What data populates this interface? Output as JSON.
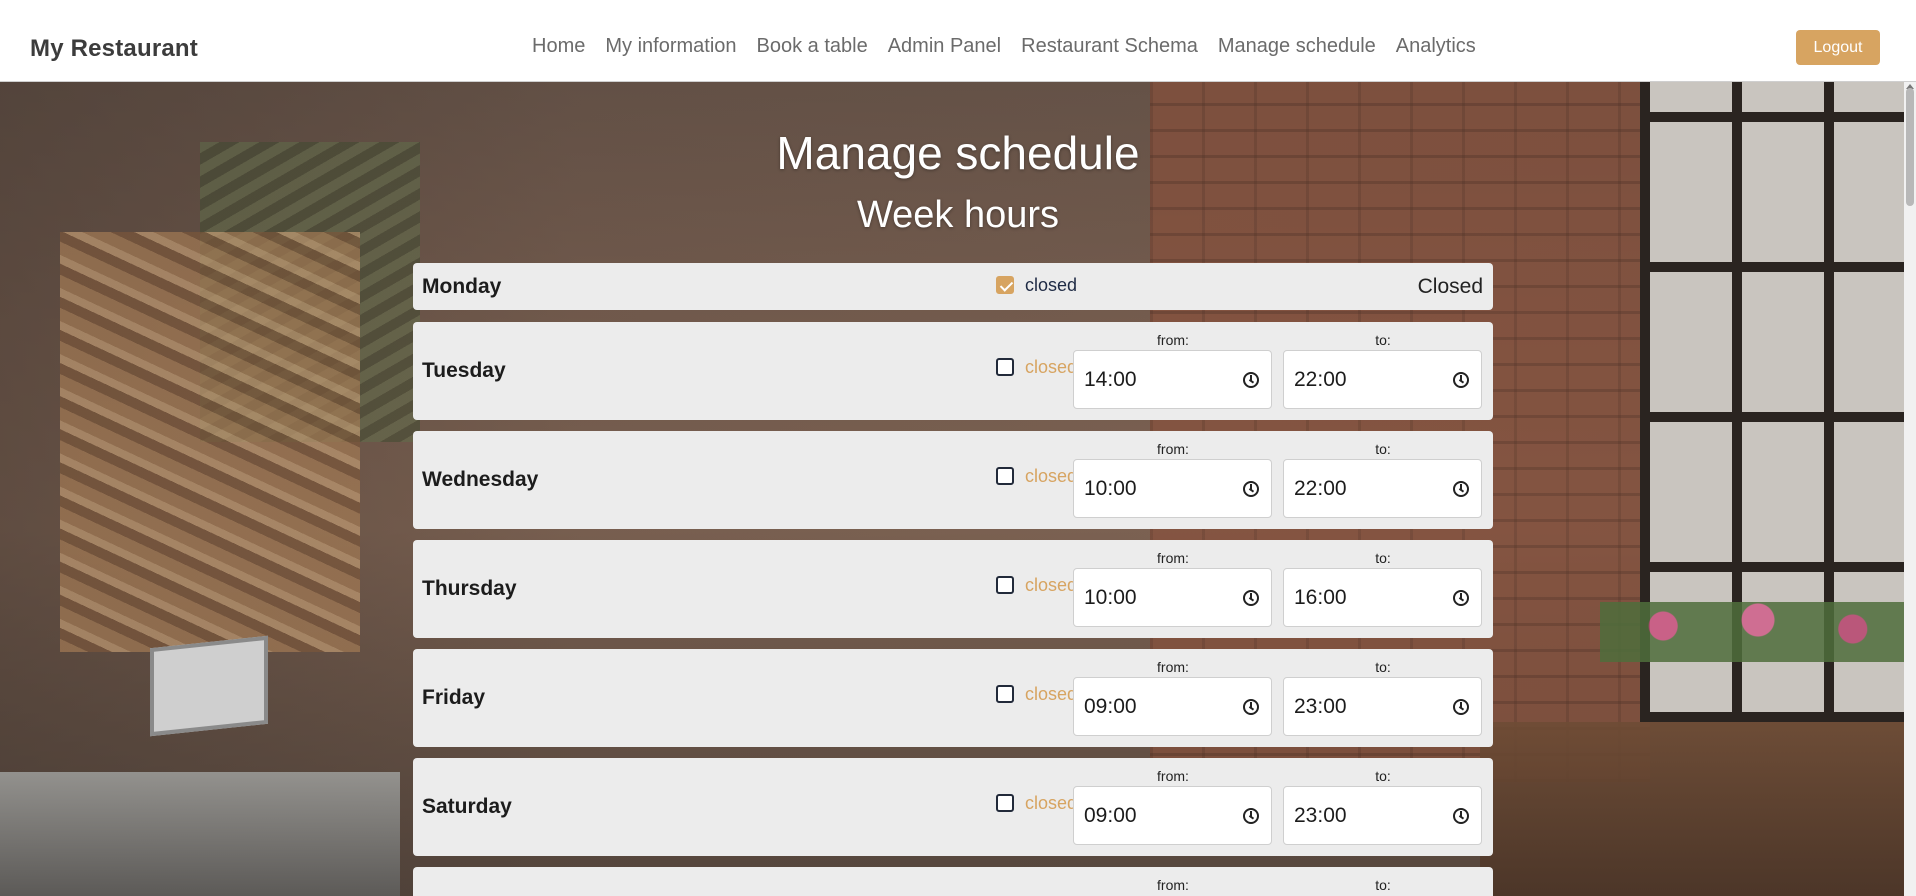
{
  "header": {
    "brand": "My Restaurant",
    "nav": [
      "Home",
      "My information",
      "Book a table",
      "Admin Panel",
      "Restaurant Schema",
      "Manage schedule",
      "Analytics"
    ],
    "logout_label": "Logout"
  },
  "page": {
    "title": "Manage schedule",
    "subtitle": "Week hours"
  },
  "labels": {
    "from": "from:",
    "to": "to:",
    "closed_checkbox": "closed",
    "closed_status": "Closed"
  },
  "days": [
    {
      "name": "Monday",
      "closed": true
    },
    {
      "name": "Tuesday",
      "closed": false,
      "from": "14:00",
      "to": "22:00"
    },
    {
      "name": "Wednesday",
      "closed": false,
      "from": "10:00",
      "to": "22:00"
    },
    {
      "name": "Thursday",
      "closed": false,
      "from": "10:00",
      "to": "16:00"
    },
    {
      "name": "Friday",
      "closed": false,
      "from": "09:00",
      "to": "23:00"
    },
    {
      "name": "Saturday",
      "closed": false,
      "from": "09:00",
      "to": "23:00"
    }
  ],
  "colors": {
    "accent": "#d7a461",
    "row_bg": "#ececec"
  }
}
